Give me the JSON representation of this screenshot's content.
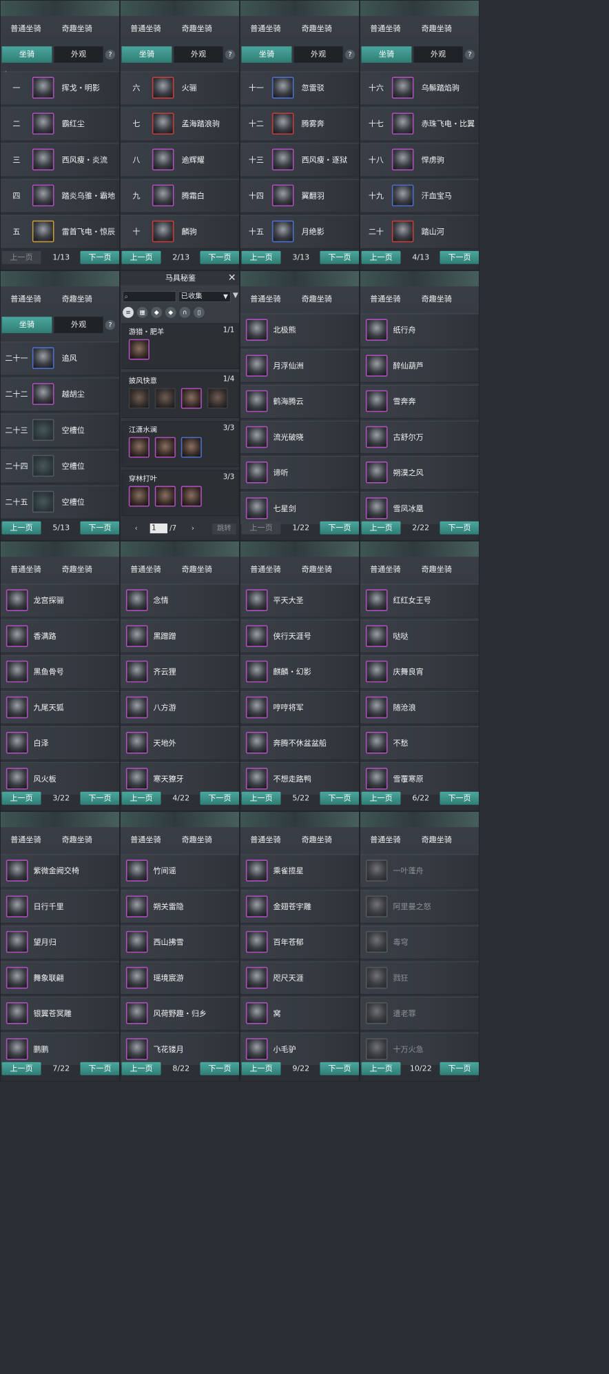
{
  "tabs": {
    "normal": "普通坐骑",
    "fun": "奇趣坐骑"
  },
  "subtabs": {
    "mount": "坐骑",
    "look": "外观",
    "help": "?"
  },
  "pager": {
    "prev": "上一页",
    "next": "下一页"
  },
  "panels": [
    {
      "page": "1/13",
      "prev_disabled": true,
      "subtabs": true,
      "numbered": true,
      "corner": true,
      "rows": [
        {
          "num": "一",
          "name": "挥戈・明影"
        },
        {
          "num": "二",
          "name": "霸红尘"
        },
        {
          "num": "三",
          "name": "西风瘦・炎流"
        },
        {
          "num": "四",
          "name": "踏炎乌骓・霸地"
        },
        {
          "num": "五",
          "name": "雷首飞电・惊辰",
          "color": "gold"
        }
      ]
    },
    {
      "page": "2/13",
      "subtabs": true,
      "numbered": true,
      "rows": [
        {
          "num": "六",
          "name": "火骊",
          "color": "red"
        },
        {
          "num": "七",
          "name": "孟海踏浪驹",
          "color": "red"
        },
        {
          "num": "八",
          "name": "逾辉耀"
        },
        {
          "num": "九",
          "name": "腾霜白"
        },
        {
          "num": "十",
          "name": "麟驹",
          "color": "red"
        }
      ]
    },
    {
      "page": "3/13",
      "subtabs": true,
      "numbered": true,
      "rows": [
        {
          "num": "十一",
          "name": "忽雷驳",
          "color": "blue"
        },
        {
          "num": "十二",
          "name": "腾雾奔",
          "color": "red"
        },
        {
          "num": "十三",
          "name": "西风瘦・逐狱"
        },
        {
          "num": "十四",
          "name": "翼翻羽"
        },
        {
          "num": "十五",
          "name": "月绝影",
          "color": "blue"
        }
      ]
    },
    {
      "page": "4/13",
      "subtabs": true,
      "numbered": true,
      "rows": [
        {
          "num": "十六",
          "name": "乌鬃踏焰驹"
        },
        {
          "num": "十七",
          "name": "赤珠飞电・比翼"
        },
        {
          "num": "十八",
          "name": "悍虏驹"
        },
        {
          "num": "十九",
          "name": "汗血宝马",
          "color": "blue"
        },
        {
          "num": "二十",
          "name": "踏山河",
          "color": "red"
        }
      ]
    },
    {
      "page": "5/13",
      "subtabs": true,
      "numbered": true,
      "rows": [
        {
          "num": "二十一",
          "name": "追风",
          "color": "blue"
        },
        {
          "num": "二十二",
          "name": "越胡尘"
        },
        {
          "num": "二十三",
          "name": "空槽位",
          "empty": true
        },
        {
          "num": "二十四",
          "name": "空槽位",
          "empty": true
        },
        {
          "num": "二十五",
          "name": "空槽位",
          "empty": true
        }
      ]
    },
    {
      "codex": true
    },
    {
      "page": "1/22",
      "prev_disabled": true,
      "numbered": false,
      "rows": [
        {
          "name": "北极熊"
        },
        {
          "name": "月浮仙洲"
        },
        {
          "name": "鹤海腾云"
        },
        {
          "name": "流光破晓"
        },
        {
          "name": "谛听"
        },
        {
          "name": "七星剑"
        }
      ]
    },
    {
      "page": "2/22",
      "numbered": false,
      "rows": [
        {
          "name": "纸行舟"
        },
        {
          "name": "醉仙葫芦"
        },
        {
          "name": "雪奔奔"
        },
        {
          "name": "古舒尔万"
        },
        {
          "name": "朔漠之风"
        },
        {
          "name": "雪凤冰凰"
        }
      ]
    },
    {
      "page": "3/22",
      "numbered": false,
      "rows": [
        {
          "name": "龙宫探骊"
        },
        {
          "name": "香满路"
        },
        {
          "name": "黑鱼骨号"
        },
        {
          "name": "九尾天狐"
        },
        {
          "name": "白泽"
        },
        {
          "name": "风火板"
        }
      ]
    },
    {
      "page": "4/22",
      "numbered": false,
      "rows": [
        {
          "name": "念情"
        },
        {
          "name": "黑蹭蹭"
        },
        {
          "name": "齐云狸"
        },
        {
          "name": "八方游"
        },
        {
          "name": "天地外"
        },
        {
          "name": "寒天獠牙"
        }
      ]
    },
    {
      "page": "5/22",
      "numbered": false,
      "rows": [
        {
          "name": "平天大圣"
        },
        {
          "name": "侠行天涯号"
        },
        {
          "name": "麒麟・幻影"
        },
        {
          "name": "哼哼将军"
        },
        {
          "name": "奔腾不休盆盆船"
        },
        {
          "name": "不想走路鸭"
        }
      ]
    },
    {
      "page": "6/22",
      "numbered": false,
      "rows": [
        {
          "name": "红红女王号"
        },
        {
          "name": "哒哒"
        },
        {
          "name": "庆舞良宵"
        },
        {
          "name": "随沧浪"
        },
        {
          "name": "不愁"
        },
        {
          "name": "雪覆寒原"
        }
      ]
    },
    {
      "page": "7/22",
      "numbered": false,
      "rows": [
        {
          "name": "紫微金阙交椅"
        },
        {
          "name": "日行千里"
        },
        {
          "name": "望月归"
        },
        {
          "name": "舞象联翩"
        },
        {
          "name": "银翼苍冥雕"
        },
        {
          "name": "鹏鹏"
        }
      ]
    },
    {
      "page": "8/22",
      "numbered": false,
      "rows": [
        {
          "name": "竹间谣"
        },
        {
          "name": "朔关雷隐"
        },
        {
          "name": "西山拂雪"
        },
        {
          "name": "瑶境宸游"
        },
        {
          "name": "风荷野趣・归乡"
        },
        {
          "name": "飞花镂月"
        }
      ]
    },
    {
      "page": "9/22",
      "numbered": false,
      "rows": [
        {
          "name": "乘雀揽星"
        },
        {
          "name": "金翅苍宇雕"
        },
        {
          "name": "百年苍郁"
        },
        {
          "name": "咫尺天涯"
        },
        {
          "name": "窝"
        },
        {
          "name": "小毛驴"
        }
      ]
    },
    {
      "page": "10/22",
      "numbered": false,
      "rows": [
        {
          "name": "一叶蓬舟",
          "dim": true
        },
        {
          "name": "阿里曼之怒",
          "dim": true
        },
        {
          "name": "毒穹",
          "dim": true
        },
        {
          "name": "戮狂",
          "dim": true
        },
        {
          "name": "遭老罪",
          "dim": true
        },
        {
          "name": "十万火急",
          "dim": true
        }
      ]
    }
  ],
  "codex": {
    "title": "马具秘鉴",
    "close": "✕",
    "filter_value": "已收集",
    "groups": [
      {
        "title": "游猎・肥羊",
        "count": "1/1",
        "items": 1
      },
      {
        "title": "披风快意",
        "count": "1/4",
        "items": 4
      },
      {
        "title": "江潇水澜",
        "count": "3/3",
        "items": 3
      },
      {
        "title": "穿林打叶",
        "count": "3/3",
        "items": 3
      }
    ],
    "page": "1",
    "total": "/7",
    "jump": "跳转"
  }
}
